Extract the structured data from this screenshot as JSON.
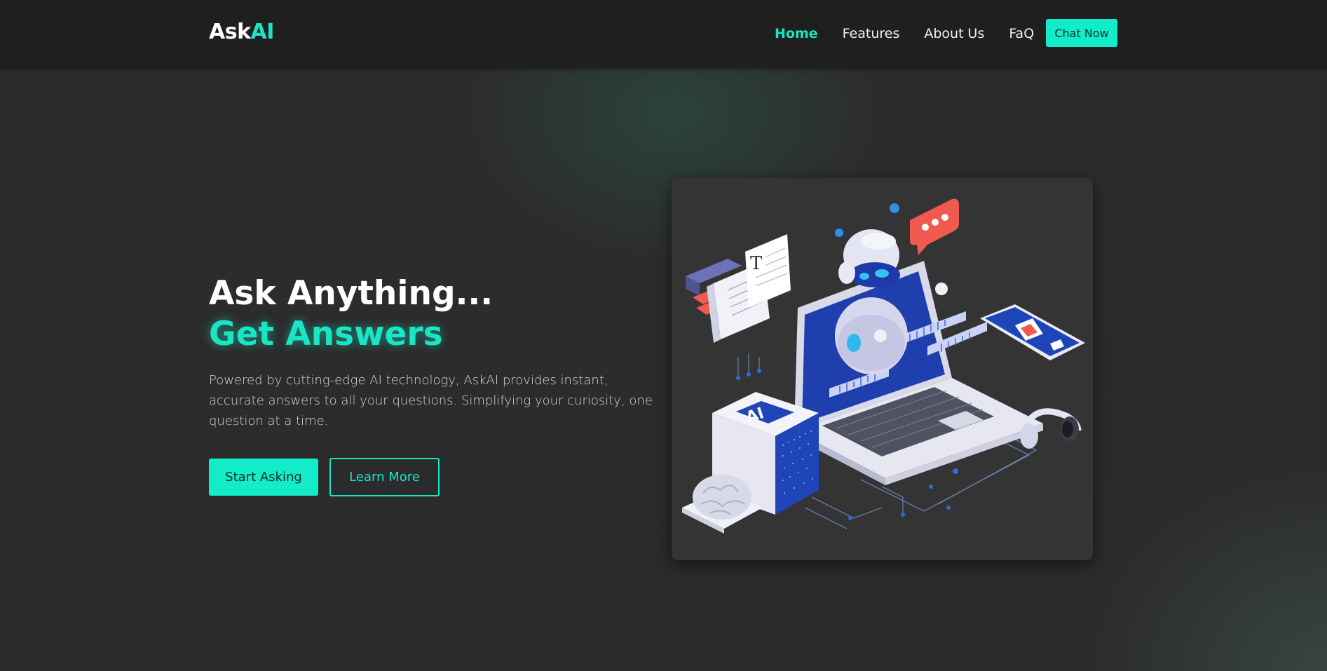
{
  "header": {
    "logo_prefix": "Ask",
    "logo_suffix": "AI",
    "nav": [
      {
        "label": "Home",
        "active": true
      },
      {
        "label": "Features",
        "active": false
      },
      {
        "label": "About Us",
        "active": false
      },
      {
        "label": "FaQ",
        "active": false
      }
    ],
    "cta_label": "Chat Now"
  },
  "hero": {
    "title_line1": "Ask Anything...",
    "title_line2": "Get Answers",
    "description": "Powered by cutting-edge AI technology, AskAI provides instant, accurate answers to all your questions. Simplifying your curiosity, one question at a time.",
    "primary_button": "Start Asking",
    "secondary_button": "Learn More"
  },
  "illustration": {
    "chip_label": "AI",
    "book_label": "T",
    "icons": [
      "robot-icon",
      "laptop-icon",
      "ai-chip-icon",
      "books-icon",
      "chat-bubble-icon",
      "phone-icon",
      "headphones-icon",
      "brain-icon"
    ]
  },
  "colors": {
    "accent": "#19e6c4",
    "button": "#12ecc9",
    "header_bg": "#1f1f1f",
    "page_bg": "#2a2a2a",
    "card_bg": "#343434"
  }
}
